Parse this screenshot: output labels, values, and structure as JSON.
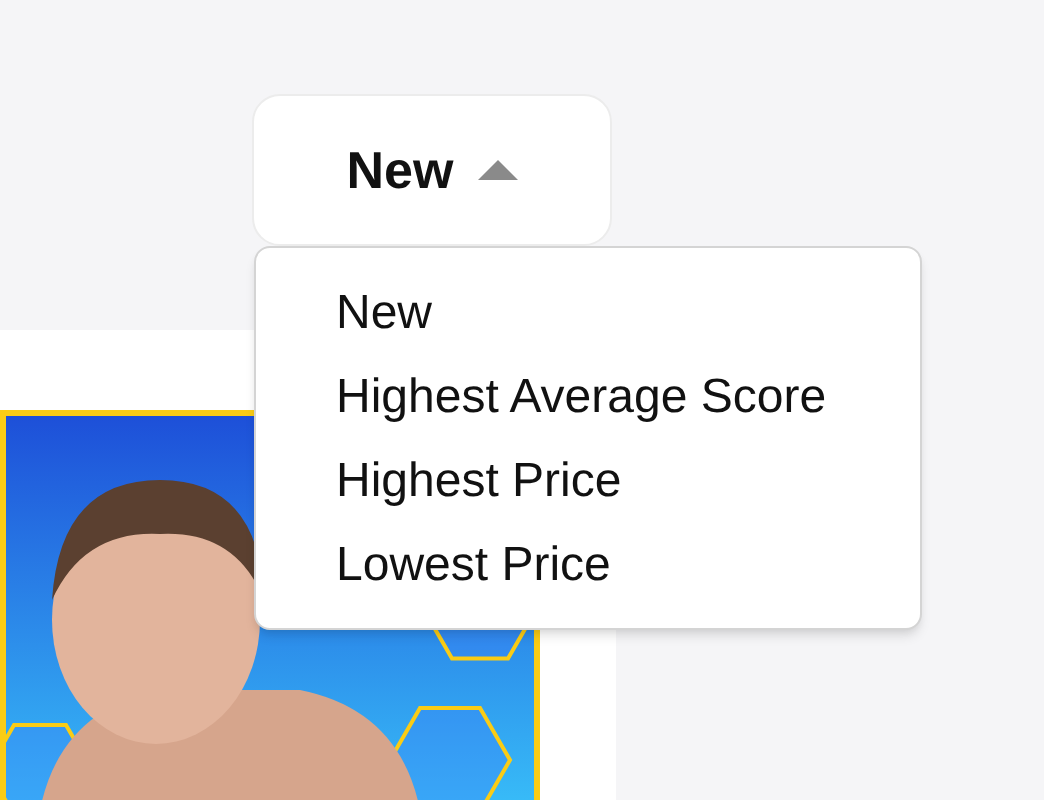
{
  "sort_button": {
    "label": "New",
    "expanded": true
  },
  "sort_menu": {
    "items": [
      {
        "label": "New"
      },
      {
        "label": "Highest Average Score"
      },
      {
        "label": "Highest Price"
      },
      {
        "label": "Lowest Price"
      }
    ]
  }
}
